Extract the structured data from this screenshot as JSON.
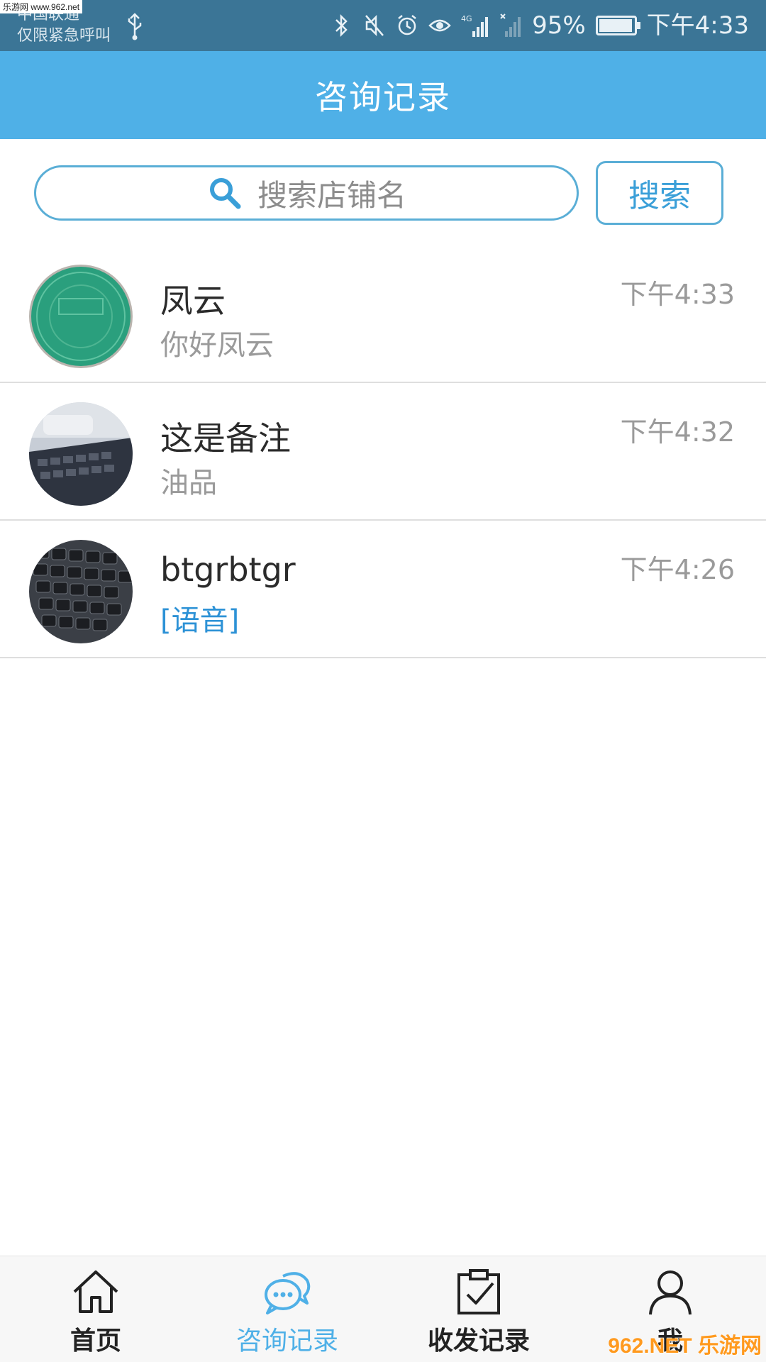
{
  "status_bar": {
    "carrier": "中国联通",
    "emergency": "仅限紧急呼叫",
    "network": "4G",
    "battery": "95%",
    "time": "下午4:33",
    "icons": [
      "usb-icon",
      "bluetooth-icon",
      "mute-icon",
      "alarm-icon",
      "eye-icon",
      "signal-icon",
      "no-signal-icon",
      "battery-icon"
    ]
  },
  "watermark_top": "乐游网 www.962.net",
  "header": {
    "title": "咨询记录"
  },
  "search": {
    "placeholder": "搜索店铺名",
    "button_label": "搜索"
  },
  "conversations": [
    {
      "name": "凤云",
      "message": "你好凤云",
      "time": "下午4:33",
      "avatar": "green-seal-photo"
    },
    {
      "name": "这是备注",
      "message": "油品",
      "time": "下午4:32",
      "avatar": "desk-keyboard-photo"
    },
    {
      "name": "btgrbtgr",
      "message": "[语音]",
      "time": "下午4:26",
      "avatar": "keyboard-photo"
    }
  ],
  "bottom_nav": {
    "items": [
      {
        "label": "首页",
        "icon": "home-icon",
        "active": false
      },
      {
        "label": "咨询记录",
        "icon": "chat-icon",
        "active": true
      },
      {
        "label": "收发记录",
        "icon": "clipboard-check-icon",
        "active": false
      },
      {
        "label": "我",
        "icon": "user-icon",
        "active": false
      }
    ]
  },
  "colors": {
    "accent": "#4fb0e7",
    "status_bar": "#3b7596",
    "voice_text": "#2d92d6"
  },
  "watermark_bottom": "962.NET 乐游网"
}
